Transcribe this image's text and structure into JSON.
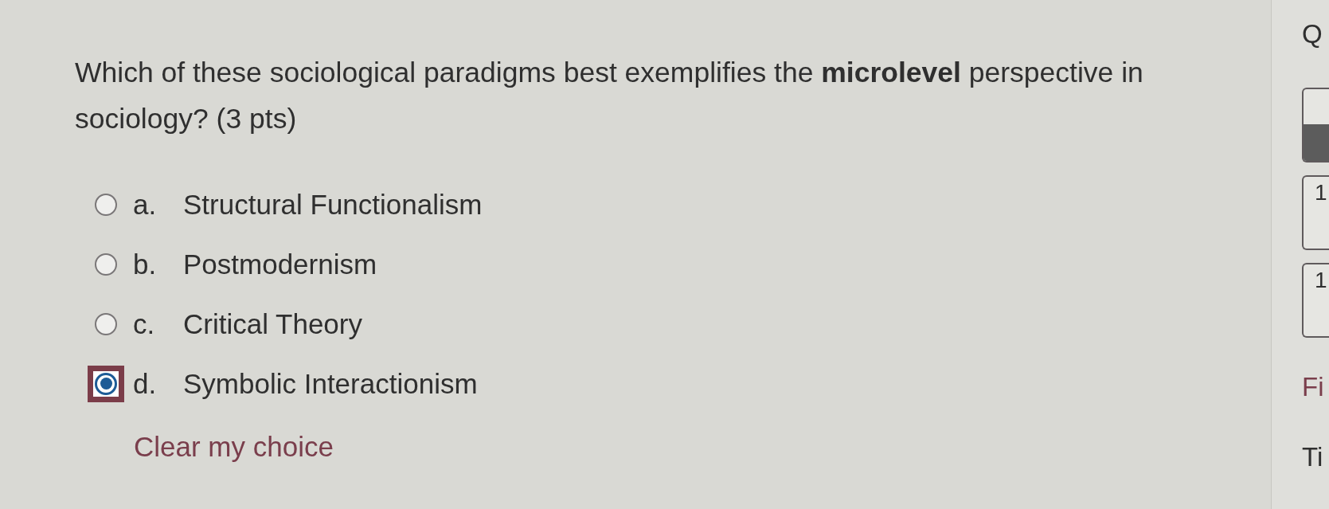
{
  "question": {
    "text": "Which of these sociological paradigms best exemplifies the **microlevel** perspective in sociology? (3 pts)"
  },
  "options": [
    {
      "letter": "a.",
      "label": "Structural Functionalism",
      "selected": false,
      "focused": false
    },
    {
      "letter": "b.",
      "label": "Postmodernism",
      "selected": false,
      "focused": false
    },
    {
      "letter": "c.",
      "label": "Critical Theory",
      "selected": false,
      "focused": false
    },
    {
      "letter": "d.",
      "label": "Symbolic Interactionism",
      "selected": true,
      "focused": true
    }
  ],
  "clear_link": "Clear my choice",
  "side_panel": {
    "heading": "Q",
    "nav_boxes": [
      {
        "answered": true
      },
      {
        "number": "1",
        "answered": false
      },
      {
        "number": "1",
        "answered": false
      }
    ],
    "link": "Fi",
    "label": "Ti"
  }
}
